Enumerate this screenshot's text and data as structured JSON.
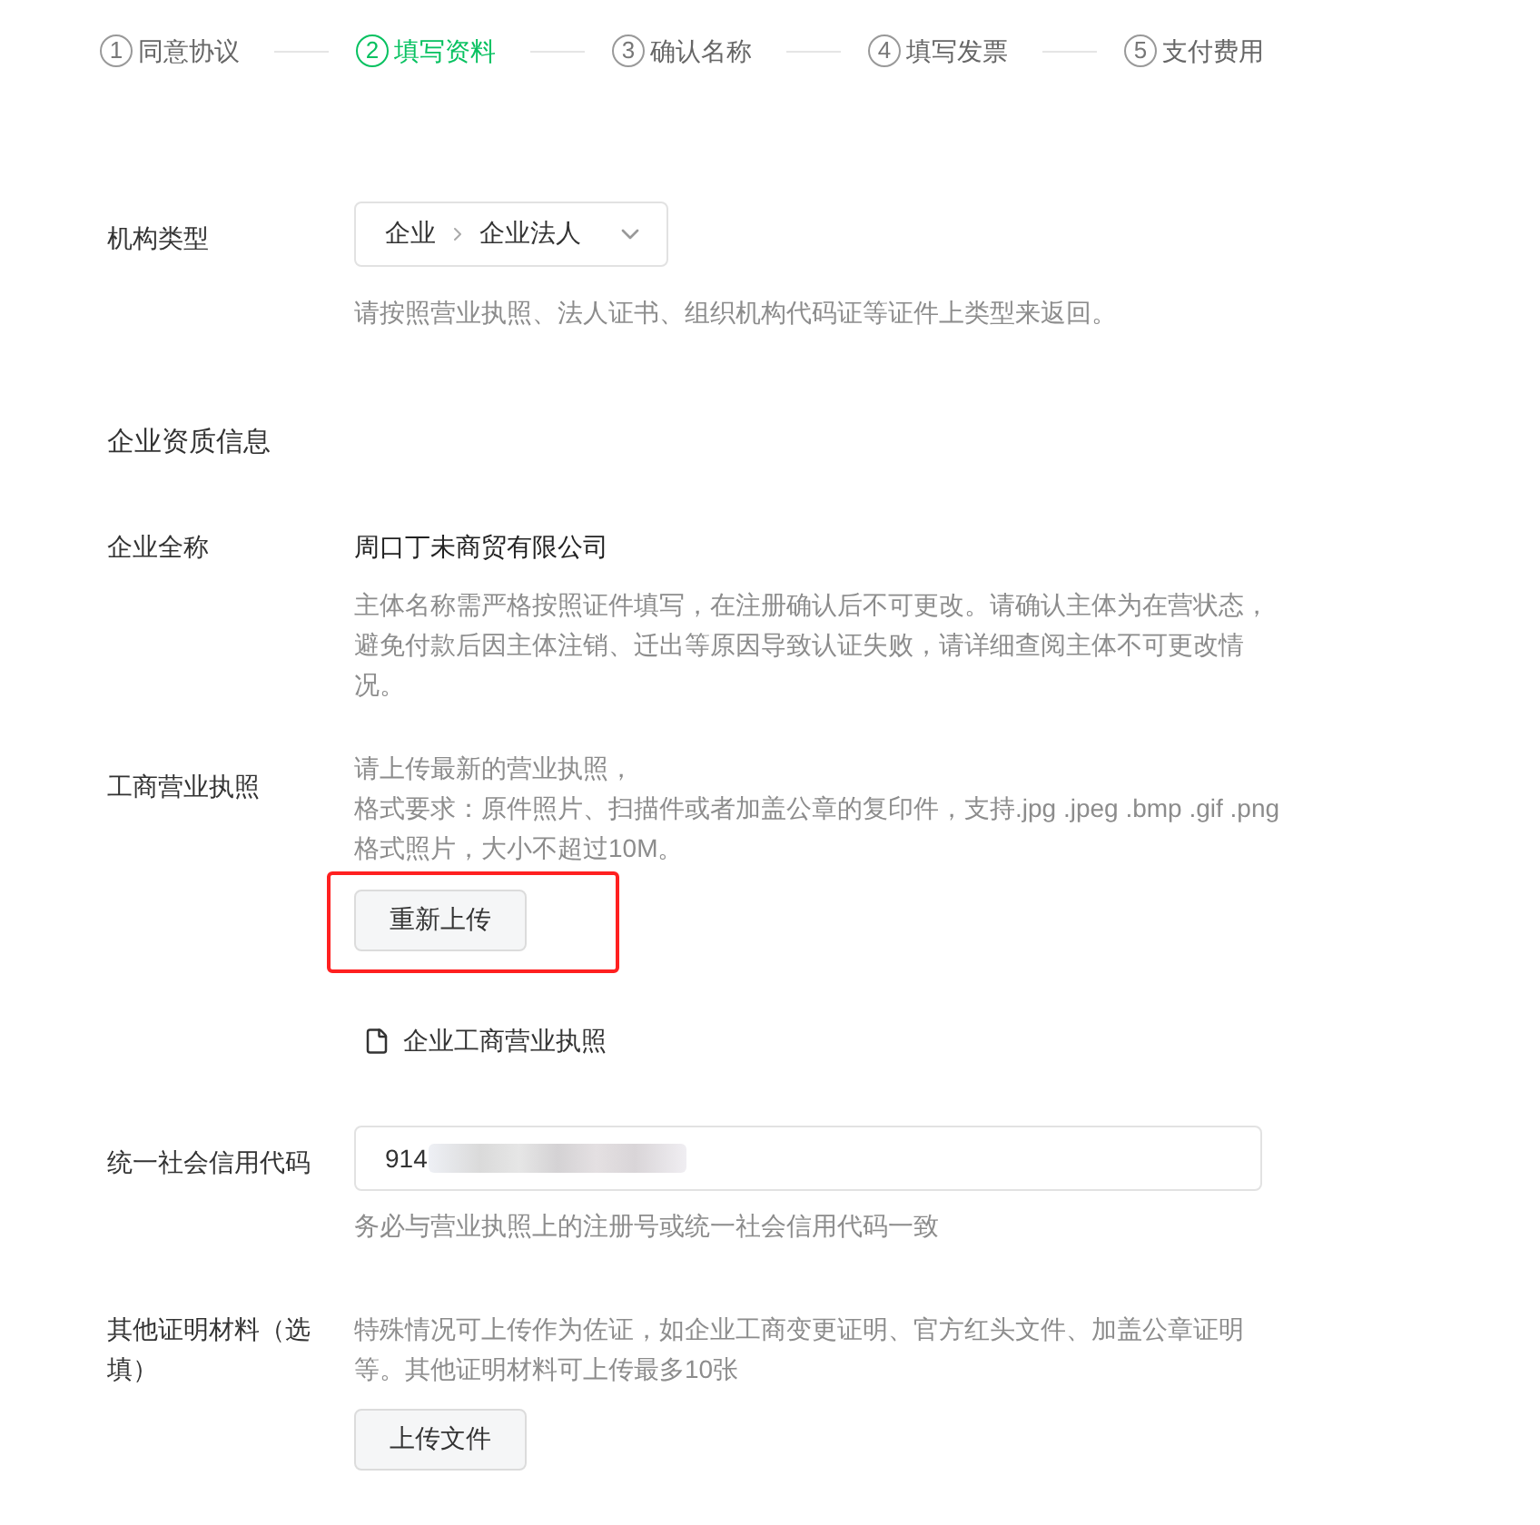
{
  "steps": [
    {
      "number": "1",
      "label": "同意协议",
      "selected": false
    },
    {
      "number": "2",
      "label": "填写资料",
      "selected": true
    },
    {
      "number": "3",
      "label": "确认名称",
      "selected": false
    },
    {
      "number": "4",
      "label": "填写发票",
      "selected": false
    },
    {
      "number": "5",
      "label": "支付费用",
      "selected": false
    }
  ],
  "org_type": {
    "label": "机构类型",
    "select": {
      "path": [
        "企业",
        "企业法人"
      ]
    },
    "hint": "请按照营业执照、法人证书、组织机构代码证等证件上类型来返回。"
  },
  "section_title": "企业资质信息",
  "company_name": {
    "label": "企业全称",
    "value": "周口丁未商贸有限公司",
    "hint": "主体名称需严格按照证件填写，在注册确认后不可更改。请确认主体为在营状态，避免付款后因主体注销、迁出等原因导致认证失败，请详细查阅主体不可更改情况。"
  },
  "business_license": {
    "label": "工商营业执照",
    "hint_lines": [
      "请上传最新的营业执照，",
      "格式要求：原件照片、扫描件或者加盖公章的复印件，支持.jpg .jpeg .bmp .gif .png格式照片，大小不超过10M。"
    ],
    "button": {
      "label": "重新上传",
      "highlighted": true
    },
    "file": {
      "name": "企业工商营业执照"
    }
  },
  "credit_code": {
    "label": "统一社会信用代码",
    "value": "914",
    "redacted": true,
    "hint": "务必与营业执照上的注册号或统一社会信用代码一致"
  },
  "other_docs": {
    "label": "其他证明材料（选填）",
    "hint": "特殊情况可上传作为佐证，如企业工商变更证明、官方红头文件、加盖公章证明等。其他证明材料可上传最多10张",
    "button": {
      "label": "上传文件"
    }
  }
}
